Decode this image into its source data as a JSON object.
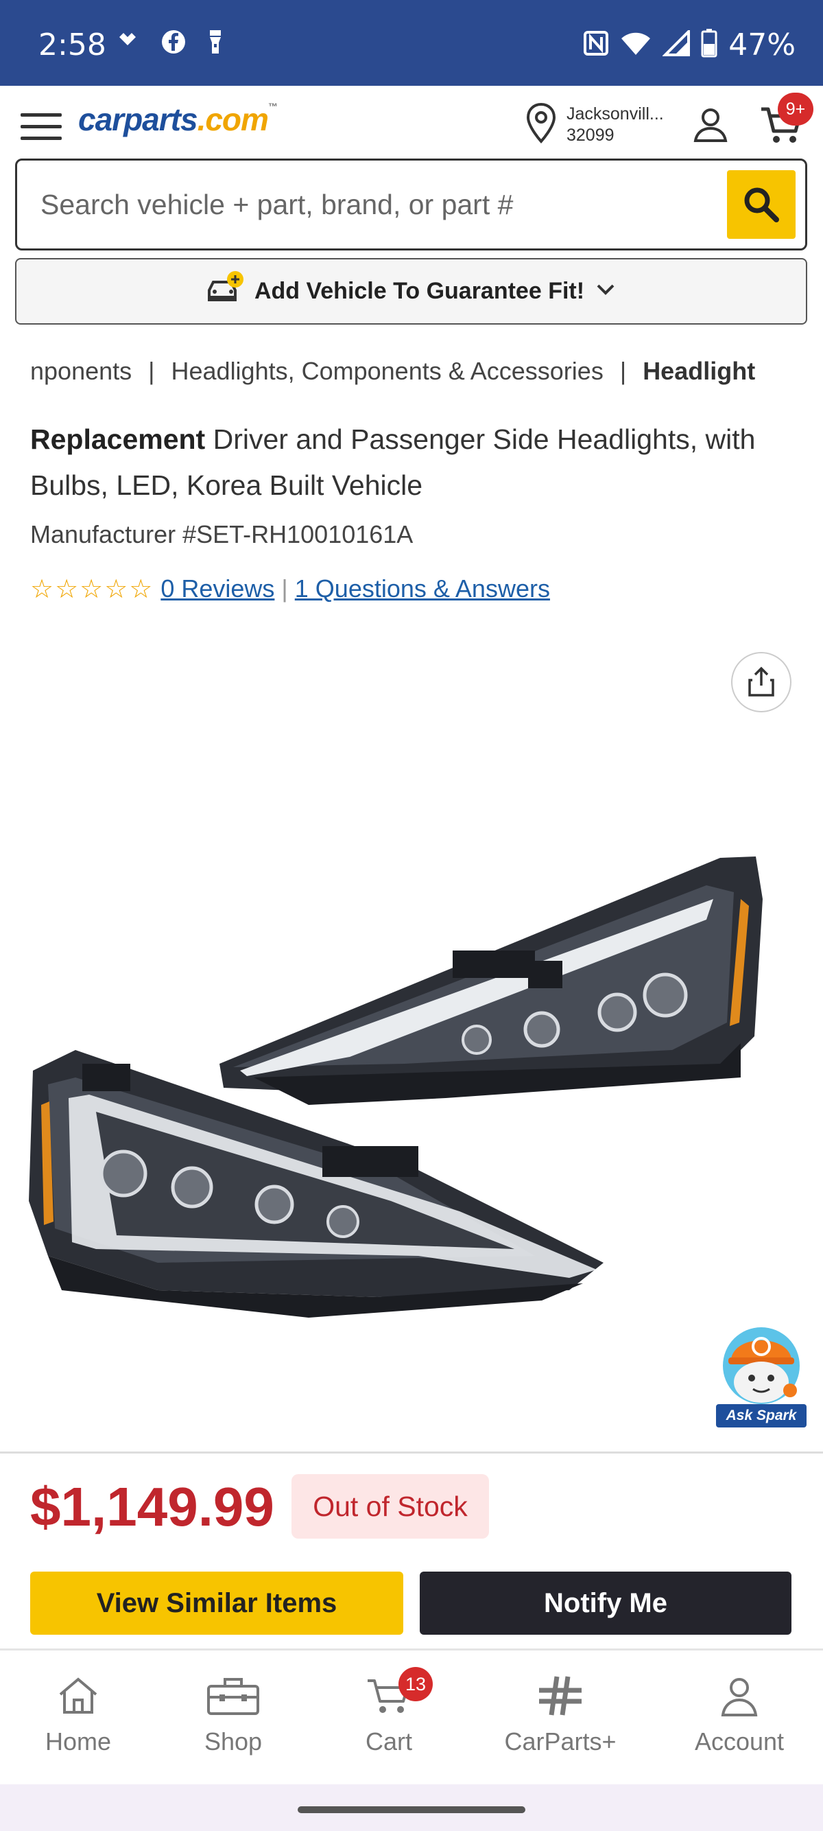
{
  "status_bar": {
    "time": "2:58",
    "battery": "47%",
    "icons_left": [
      "tidal-icon",
      "facebook-icon",
      "flashlight-icon"
    ],
    "icons_right": [
      "nfc-icon",
      "wifi-icon",
      "signal-icon",
      "battery-icon"
    ]
  },
  "header": {
    "logo_main": "carparts",
    "logo_suffix": ".com",
    "logo_tm": "™",
    "location_city": "Jacksonvill...",
    "location_zip": "32099",
    "cart_badge": "9+"
  },
  "search": {
    "placeholder": "Search vehicle + part, brand, or part #"
  },
  "vehicle": {
    "label": "Add Vehicle To Guarantee Fit!"
  },
  "breadcrumb": {
    "items": [
      "nponents",
      "Headlights, Components & Accessories",
      "Headlight"
    ],
    "separator": "|"
  },
  "product": {
    "title_bold": "Replacement",
    "title_rest": " Driver and Passenger Side Headlights, with Bulbs, LED, Korea Built Vehicle",
    "mfr_number": "Manufacturer #SET-RH10010161A",
    "stars": "☆☆☆☆☆",
    "rating_out_of": 5,
    "reviews_link": "0 Reviews",
    "qa_link": "1 Questions & Answers",
    "price": "$1,149.99",
    "stock_status": "Out of Stock"
  },
  "assistant": {
    "label": "Ask Spark"
  },
  "actions": {
    "similar": "View Similar Items",
    "notify": "Notify Me"
  },
  "bottom_nav": {
    "home": "Home",
    "shop": "Shop",
    "cart": "Cart",
    "cart_badge": "13",
    "carparts_plus": "CarParts+",
    "account": "Account"
  },
  "colors": {
    "brand_blue": "#1e4f9c",
    "accent_yellow": "#f7c400",
    "price_red": "#c0262d",
    "status_bar": "#2b4a8f"
  }
}
